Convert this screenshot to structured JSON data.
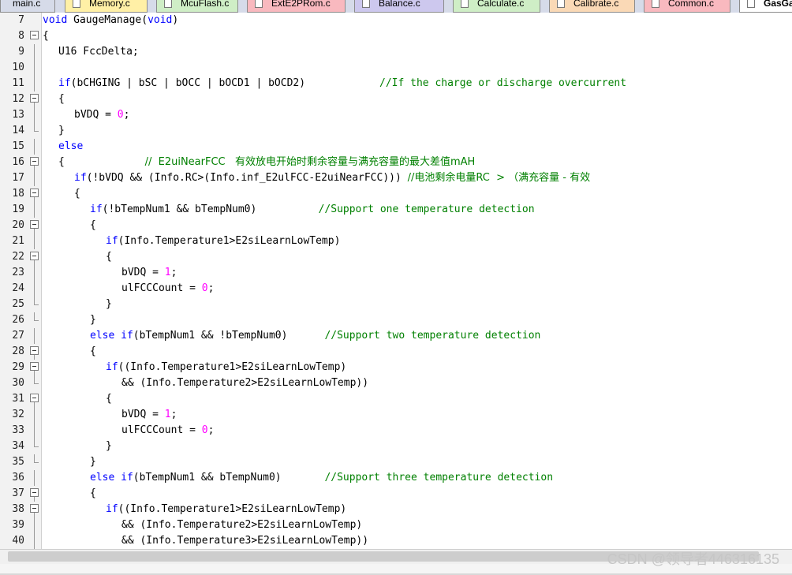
{
  "tabs": [
    {
      "label": "main.c",
      "color": "#d6dbe9",
      "active": false
    },
    {
      "label": "Memory.c",
      "color": "#fff0a6",
      "active": false
    },
    {
      "label": "McuFlash.c",
      "color": "#cfeec6",
      "active": false
    },
    {
      "label": "ExtE2PRom.c",
      "color": "#f9b9bf",
      "active": false
    },
    {
      "label": "Balance.c",
      "color": "#cdc8ee",
      "active": false
    },
    {
      "label": "Calculate.c",
      "color": "#cfeec6",
      "active": false
    },
    {
      "label": "Calibrate.c",
      "color": "#fad9b6",
      "active": false
    },
    {
      "label": "Common.c",
      "color": "#f9b9bf",
      "active": false
    },
    {
      "label": "GasGa",
      "color": "#ffffff",
      "active": true
    }
  ],
  "colors": {
    "keyword": "#0000ff",
    "number": "#ff00ff",
    "comment": "#008000",
    "text": "#000000"
  },
  "lines": [
    {
      "num": "7",
      "fold": "none",
      "indent": 0,
      "tokens": [
        {
          "t": "kw",
          "v": "void"
        },
        {
          "t": "p",
          "v": " GaugeManage("
        },
        {
          "t": "kw",
          "v": "void"
        },
        {
          "t": "p",
          "v": ")"
        }
      ]
    },
    {
      "num": "8",
      "fold": "box-top",
      "indent": 0,
      "tokens": [
        {
          "t": "p",
          "v": "{"
        }
      ]
    },
    {
      "num": "9",
      "fold": "vline",
      "indent": 1,
      "tokens": [
        {
          "t": "p",
          "v": "U16 FccDelta;"
        }
      ]
    },
    {
      "num": "10",
      "fold": "vline",
      "indent": 0,
      "tokens": []
    },
    {
      "num": "11",
      "fold": "vline",
      "indent": 1,
      "tokens": [
        {
          "t": "kw",
          "v": "if"
        },
        {
          "t": "p",
          "v": "(bCHGING | bSC | bOCC | bOCD1 | bOCD2)            "
        },
        {
          "t": "cm",
          "v": "//If the charge or discharge overcurrent"
        }
      ]
    },
    {
      "num": "12",
      "fold": "box",
      "indent": 1,
      "tokens": [
        {
          "t": "p",
          "v": "{"
        }
      ]
    },
    {
      "num": "13",
      "fold": "vline",
      "indent": 2,
      "tokens": [
        {
          "t": "p",
          "v": "bVDQ = "
        },
        {
          "t": "num",
          "v": "0"
        },
        {
          "t": "p",
          "v": ";"
        }
      ]
    },
    {
      "num": "14",
      "fold": "end",
      "indent": 1,
      "tokens": [
        {
          "t": "p",
          "v": "}"
        }
      ]
    },
    {
      "num": "15",
      "fold": "vline",
      "indent": 1,
      "tokens": [
        {
          "t": "kw",
          "v": "else"
        }
      ]
    },
    {
      "num": "16",
      "fold": "box",
      "indent": 1,
      "tokens": [
        {
          "t": "p",
          "v": "{             "
        },
        {
          "t": "cm",
          "v": "//  E2uiNearFCC   有效放电开始时剩余容量与满充容量的最大差值mAH"
        }
      ]
    },
    {
      "num": "17",
      "fold": "vline",
      "indent": 2,
      "tokens": [
        {
          "t": "kw",
          "v": "if"
        },
        {
          "t": "p",
          "v": "(!bVDQ && (Info.RC>(Info.inf_E2ulFCC-E2uiNearFCC))) "
        },
        {
          "t": "cm",
          "v": "//电池剩余电量RC  > （满充容量 - 有效"
        }
      ]
    },
    {
      "num": "18",
      "fold": "box",
      "indent": 2,
      "tokens": [
        {
          "t": "p",
          "v": "{"
        }
      ]
    },
    {
      "num": "19",
      "fold": "vline",
      "indent": 3,
      "tokens": [
        {
          "t": "kw",
          "v": "if"
        },
        {
          "t": "p",
          "v": "(!bTempNum1 && bTempNum0)          "
        },
        {
          "t": "cm",
          "v": "//Support one temperature detection"
        }
      ]
    },
    {
      "num": "20",
      "fold": "box",
      "indent": 3,
      "tokens": [
        {
          "t": "p",
          "v": "{"
        }
      ]
    },
    {
      "num": "21",
      "fold": "vline",
      "indent": 4,
      "tokens": [
        {
          "t": "kw",
          "v": "if"
        },
        {
          "t": "p",
          "v": "(Info.Temperature1>E2siLearnLowTemp)"
        }
      ]
    },
    {
      "num": "22",
      "fold": "box",
      "indent": 4,
      "tokens": [
        {
          "t": "p",
          "v": "{"
        }
      ]
    },
    {
      "num": "23",
      "fold": "vline",
      "indent": 5,
      "tokens": [
        {
          "t": "p",
          "v": "bVDQ = "
        },
        {
          "t": "num",
          "v": "1"
        },
        {
          "t": "p",
          "v": ";"
        }
      ]
    },
    {
      "num": "24",
      "fold": "vline",
      "indent": 5,
      "tokens": [
        {
          "t": "p",
          "v": "ulFCCCount = "
        },
        {
          "t": "num",
          "v": "0"
        },
        {
          "t": "p",
          "v": ";"
        }
      ]
    },
    {
      "num": "25",
      "fold": "end",
      "indent": 4,
      "tokens": [
        {
          "t": "p",
          "v": "}"
        }
      ]
    },
    {
      "num": "26",
      "fold": "end",
      "indent": 3,
      "tokens": [
        {
          "t": "p",
          "v": "}"
        }
      ]
    },
    {
      "num": "27",
      "fold": "vline",
      "indent": 3,
      "tokens": [
        {
          "t": "kw",
          "v": "else if"
        },
        {
          "t": "p",
          "v": "(bTempNum1 && !bTempNum0)      "
        },
        {
          "t": "cm",
          "v": "//Support two temperature detection"
        }
      ]
    },
    {
      "num": "28",
      "fold": "box",
      "indent": 3,
      "tokens": [
        {
          "t": "p",
          "v": "{"
        }
      ]
    },
    {
      "num": "29",
      "fold": "box",
      "indent": 4,
      "tokens": [
        {
          "t": "kw",
          "v": "if"
        },
        {
          "t": "p",
          "v": "((Info.Temperature1>E2siLearnLowTemp)"
        }
      ]
    },
    {
      "num": "30",
      "fold": "end",
      "indent": 5,
      "tokens": [
        {
          "t": "p",
          "v": "&& (Info.Temperature2>E2siLearnLowTemp))"
        }
      ]
    },
    {
      "num": "31",
      "fold": "box",
      "indent": 4,
      "tokens": [
        {
          "t": "p",
          "v": "{"
        }
      ]
    },
    {
      "num": "32",
      "fold": "vline",
      "indent": 5,
      "tokens": [
        {
          "t": "p",
          "v": "bVDQ = "
        },
        {
          "t": "num",
          "v": "1"
        },
        {
          "t": "p",
          "v": ";"
        }
      ]
    },
    {
      "num": "33",
      "fold": "vline",
      "indent": 5,
      "tokens": [
        {
          "t": "p",
          "v": "ulFCCCount = "
        },
        {
          "t": "num",
          "v": "0"
        },
        {
          "t": "p",
          "v": ";"
        }
      ]
    },
    {
      "num": "34",
      "fold": "end",
      "indent": 4,
      "tokens": [
        {
          "t": "p",
          "v": "}"
        }
      ]
    },
    {
      "num": "35",
      "fold": "end",
      "indent": 3,
      "tokens": [
        {
          "t": "p",
          "v": "}"
        }
      ]
    },
    {
      "num": "36",
      "fold": "vline",
      "indent": 3,
      "tokens": [
        {
          "t": "kw",
          "v": "else if"
        },
        {
          "t": "p",
          "v": "(bTempNum1 && bTempNum0)       "
        },
        {
          "t": "cm",
          "v": "//Support three temperature detection"
        }
      ]
    },
    {
      "num": "37",
      "fold": "box",
      "indent": 3,
      "tokens": [
        {
          "t": "p",
          "v": "{"
        }
      ]
    },
    {
      "num": "38",
      "fold": "box",
      "indent": 4,
      "tokens": [
        {
          "t": "kw",
          "v": "if"
        },
        {
          "t": "p",
          "v": "((Info.Temperature1>E2siLearnLowTemp)"
        }
      ]
    },
    {
      "num": "39",
      "fold": "vline",
      "indent": 5,
      "tokens": [
        {
          "t": "p",
          "v": "&& (Info.Temperature2>E2siLearnLowTemp)"
        }
      ]
    },
    {
      "num": "40",
      "fold": "vline",
      "indent": 5,
      "tokens": [
        {
          "t": "p",
          "v": "&& (Info.Temperature3>E2siLearnLowTemp))"
        }
      ]
    }
  ],
  "watermark": "CSDN @领导者446316135"
}
